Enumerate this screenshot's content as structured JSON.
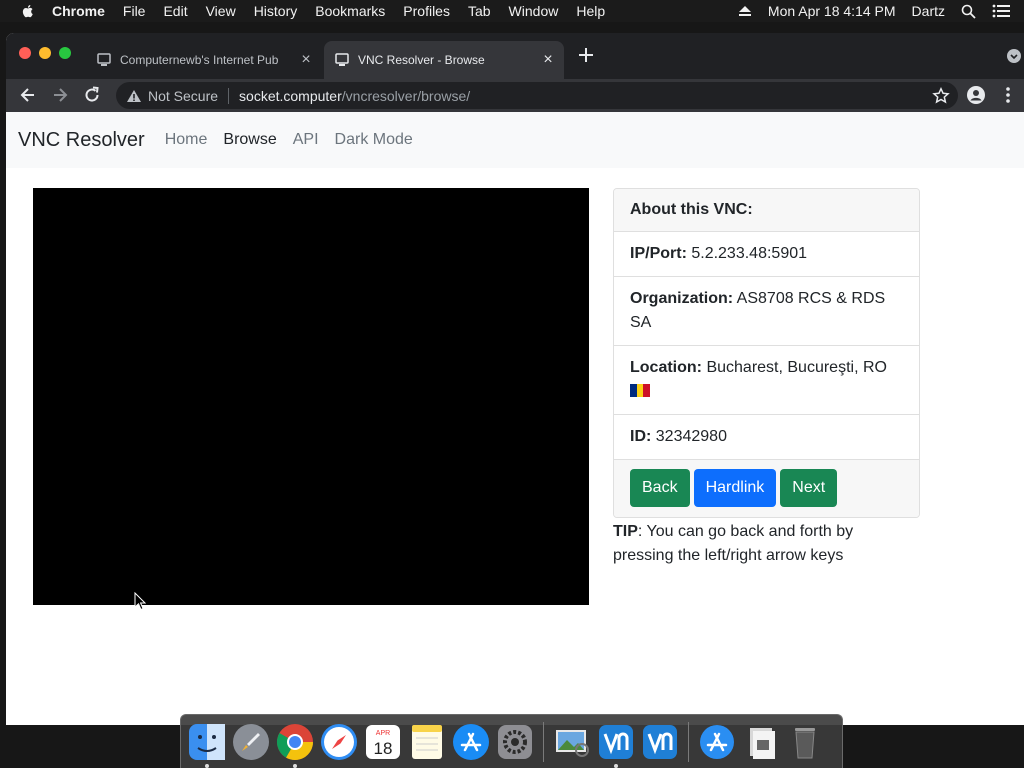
{
  "menubar": {
    "app_name": "Chrome",
    "menus": [
      "File",
      "Edit",
      "View",
      "History",
      "Bookmarks",
      "Profiles",
      "Tab",
      "Window",
      "Help"
    ],
    "clock": "Mon Apr 18  4:14 PM",
    "user": "Dartz"
  },
  "browser": {
    "tabs": [
      {
        "title": "Computernewb's Internet Pub",
        "close": "×"
      },
      {
        "title": "VNC Resolver - Browse",
        "close": "×"
      }
    ],
    "omnibox": {
      "security": "Not Secure",
      "host": "socket.computer",
      "path": "/vncresolver/browse/"
    }
  },
  "page": {
    "brand": "VNC Resolver",
    "nav": [
      "Home",
      "Browse",
      "API",
      "Dark Mode"
    ],
    "card": {
      "header": "About this VNC:",
      "ip_label": "IP/Port:",
      "ip_value": "5.2.233.48:5901",
      "org_label": "Organization:",
      "org_value": "AS8708 RCS & RDS SA",
      "loc_label": "Location:",
      "loc_value": "Bucharest, Bucureşti, RO",
      "id_label": "ID:",
      "id_value": "32342980",
      "buttons": {
        "back": "Back",
        "hardlink": "Hardlink",
        "next": "Next"
      }
    },
    "tip_label": "TIP",
    "tip_text": ": You can go back and forth by pressing the left/right arrow keys"
  },
  "dock": {
    "calendar_month": "APR",
    "calendar_day": "18"
  },
  "colors": {
    "btn_green": "#198754",
    "btn_blue": "#0d6efd",
    "flag_romania": [
      "#002b7f",
      "#fcd116",
      "#ce1126"
    ]
  }
}
